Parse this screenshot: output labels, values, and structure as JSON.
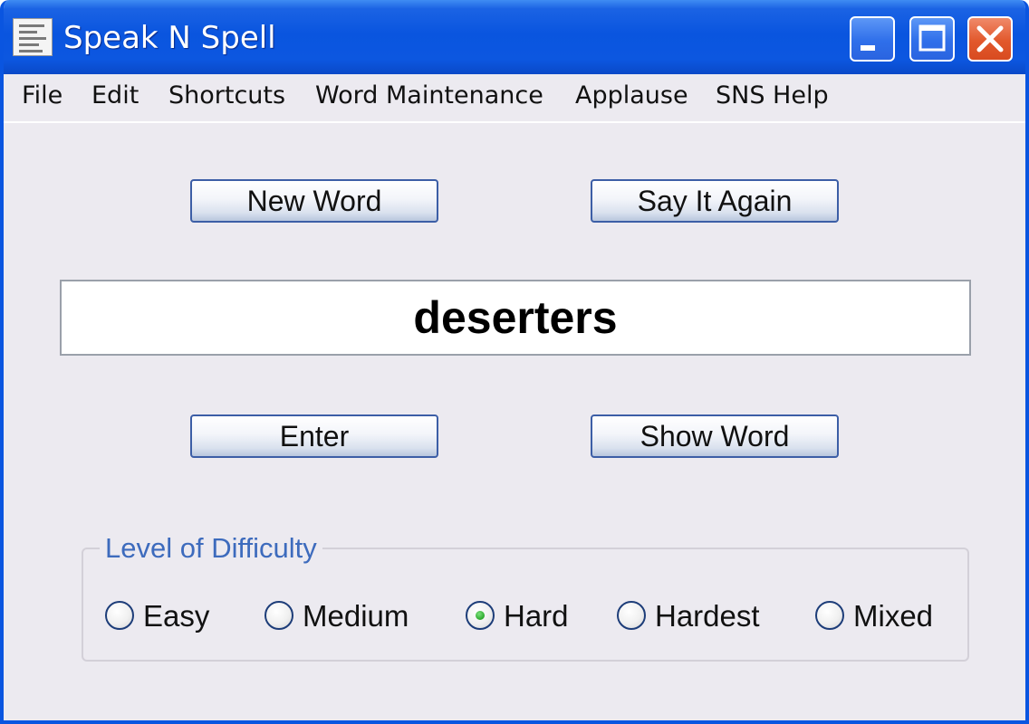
{
  "window": {
    "title": "Speak N Spell"
  },
  "menu": [
    "File",
    "Edit",
    "Shortcuts",
    "Word Maintenance",
    "Applause",
    "SNS Help"
  ],
  "buttons": {
    "new_word": "New Word",
    "say_it_again": "Say It Again",
    "enter": "Enter",
    "show_word": "Show Word"
  },
  "word_display": "deserters",
  "difficulty": {
    "title": "Level of Difficulty",
    "options": [
      "Easy",
      "Medium",
      "Hard",
      "Hardest",
      "Mixed"
    ],
    "selected": "Hard"
  },
  "icons": {
    "app": "app-icon",
    "minimize": "minimize-icon",
    "maximize": "maximize-icon",
    "close": "close-icon"
  },
  "colors": {
    "titlebar": "#0a55df",
    "close_button": "#e2582c",
    "group_title": "#3d6bbd",
    "radio_selected": "#2aa82a"
  }
}
